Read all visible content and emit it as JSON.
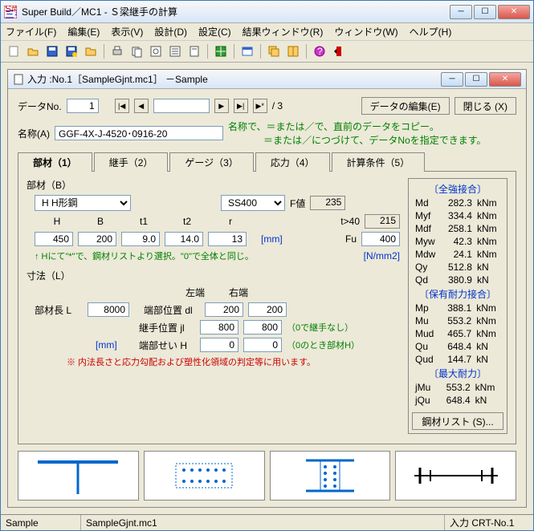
{
  "app": {
    "title": "Super Build／MC1 - Ｓ梁継手の計算"
  },
  "menu": {
    "file": "ファイル(F)",
    "edit": "編集(E)",
    "view": "表示(V)",
    "design": "設計(D)",
    "config": "設定(C)",
    "result": "結果ウィンドウ(R)",
    "window": "ウィンドウ(W)",
    "help": "ヘルプ(H)"
  },
  "child": {
    "title": "入力 :No.1［SampleGjnt.mc1］ －Sample"
  },
  "nav": {
    "dataNo_label": "データNo.",
    "dataNo_value": "1",
    "total": "/ 3",
    "edit_btn": "データの編集(E)",
    "close_btn": "閉じる (X)"
  },
  "name": {
    "label": "名称(A)",
    "value": "GGF-4X-J-4520･0916-20",
    "hint1": "名称で、＝または／で、直前のデータをコピー。",
    "hint2": "＝または／につづけて、データNoを指定できます。"
  },
  "tabs": {
    "t1": "部材（1）",
    "t2": "継手（2）",
    "t3": "ゲージ（3）",
    "t4": "応力（4）",
    "t5": "計算条件（5）"
  },
  "member": {
    "group": "部材（B）",
    "shape_select": "H H形鋼",
    "mat_select": "SS400",
    "f_label": "F値",
    "f_value": "235",
    "t_label": "t>40",
    "t_value": "215",
    "fu_label": "Fu",
    "fu_value": "400",
    "unit1": "[mm]",
    "unit2": "[N/mm2]",
    "cols": {
      "H": "H",
      "B": "B",
      "t1": "t1",
      "t2": "t2",
      "r": "r"
    },
    "vals": {
      "H": "450",
      "B": "200",
      "t1": "9.0",
      "t2": "14.0",
      "r": "13"
    },
    "note": "↑ Hにて\"*\"で、鋼材リストより選択。\"0\"で全体と同じ。"
  },
  "dim": {
    "group": "寸法（L）",
    "len_label": "部材長 L",
    "len_value": "8000",
    "left": "左端",
    "right": "右端",
    "dl_label": "端部位置 dl",
    "dl_l": "200",
    "dl_r": "200",
    "jl_label": "継手位置 jl",
    "jl_l": "800",
    "jl_r": "800",
    "jl_note": "（0で継手なし）",
    "h_label": "端部せい H",
    "h_l": "0",
    "h_r": "0",
    "h_note": "（0のとき部材H）",
    "unit": "[mm]",
    "warn": "※ 内法長さと応力勾配および塑性化領域の判定等に用います。"
  },
  "results": {
    "sec1": "〔全強接合〕",
    "md_l": "Md",
    "md_v": "282.3",
    "md_u": "kNm",
    "myf_l": "Myf",
    "myf_v": "334.4",
    "myf_u": "kNm",
    "mdf_l": "Mdf",
    "mdf_v": "258.1",
    "mdf_u": "kNm",
    "myw_l": "Myw",
    "myw_v": "42.3",
    "myw_u": "kNm",
    "mdw_l": "Mdw",
    "mdw_v": "24.1",
    "mdw_u": "kNm",
    "qy_l": "Qy",
    "qy_v": "512.8",
    "qy_u": "kN",
    "qd_l": "Qd",
    "qd_v": "380.9",
    "qd_u": "kN",
    "sec2": "〔保有耐力接合〕",
    "mp_l": "Mp",
    "mp_v": "388.1",
    "mp_u": "kNm",
    "mu_l": "Mu",
    "mu_v": "553.2",
    "mu_u": "kNm",
    "mud_l": "Mud",
    "mud_v": "465.7",
    "mud_u": "kNm",
    "qu_l": "Qu",
    "qu_v": "648.4",
    "qu_u": "kN",
    "qud_l": "Qud",
    "qud_v": "144.7",
    "qud_u": "kN",
    "sec3": "〔最大耐力〕",
    "jmu_l": "jMu",
    "jmu_v": "553.2",
    "jmu_u": "kNm",
    "jqu_l": "jQu",
    "jqu_v": "648.4",
    "jqu_u": "kN",
    "list_btn": "鋼材リスト (S)..."
  },
  "status": {
    "s1": "Sample",
    "s2": "SampleGjnt.mc1",
    "s3": "入力 CRT-No.1"
  }
}
